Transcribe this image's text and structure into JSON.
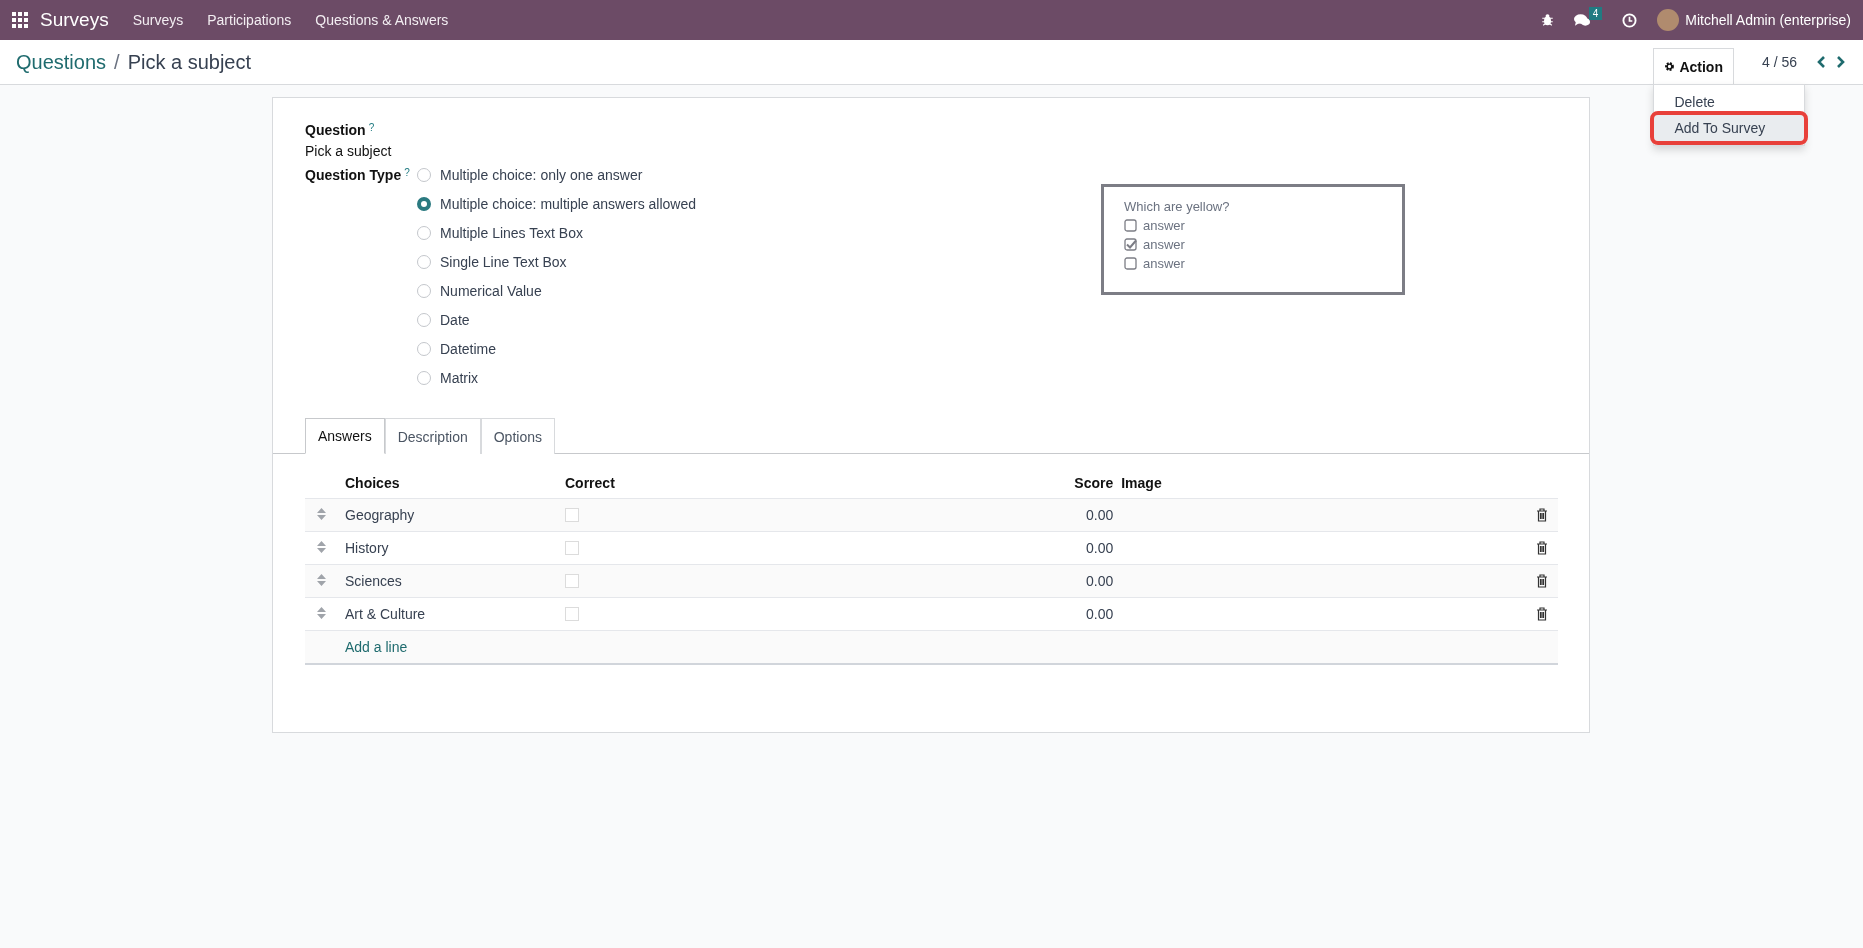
{
  "navbar": {
    "app_name": "Surveys",
    "menu": [
      "Surveys",
      "Participations",
      "Questions & Answers"
    ],
    "messages_badge": "4",
    "user": "Mitchell Admin (enterprise)"
  },
  "breadcrumb": {
    "parent": "Questions",
    "separator": "/",
    "current": "Pick a subject"
  },
  "action_menu": {
    "label": "Action",
    "open": true,
    "items": [
      {
        "label": "Delete",
        "highlighted": false
      },
      {
        "label": "Add To Survey",
        "highlighted": true
      }
    ]
  },
  "pager": "4 / 56",
  "question": {
    "label": "Question",
    "help": "?",
    "value": "Pick a subject"
  },
  "question_type": {
    "label": "Question Type",
    "help": "?",
    "options": [
      {
        "label": "Multiple choice: only one answer",
        "selected": false
      },
      {
        "label": "Multiple choice: multiple answers allowed",
        "selected": true
      },
      {
        "label": "Multiple Lines Text Box",
        "selected": false
      },
      {
        "label": "Single Line Text Box",
        "selected": false
      },
      {
        "label": "Numerical Value",
        "selected": false
      },
      {
        "label": "Date",
        "selected": false
      },
      {
        "label": "Datetime",
        "selected": false
      },
      {
        "label": "Matrix",
        "selected": false
      }
    ]
  },
  "preview": {
    "title": "Which are yellow?",
    "options": [
      {
        "label": "answer",
        "checked": false
      },
      {
        "label": "answer",
        "checked": true
      },
      {
        "label": "answer",
        "checked": false
      }
    ]
  },
  "tabs": [
    {
      "label": "Answers",
      "selected": true
    },
    {
      "label": "Description",
      "selected": false
    },
    {
      "label": "Options",
      "selected": false
    }
  ],
  "answers": {
    "columns": [
      "Choices",
      "Correct",
      "Score",
      "Image"
    ],
    "rows": [
      {
        "choice": "Geography",
        "correct": false,
        "score": "0.00"
      },
      {
        "choice": "History",
        "correct": false,
        "score": "0.00"
      },
      {
        "choice": "Sciences",
        "correct": false,
        "score": "0.00"
      },
      {
        "choice": "Art & Culture",
        "correct": false,
        "score": "0.00"
      }
    ],
    "add_line": "Add a line"
  }
}
